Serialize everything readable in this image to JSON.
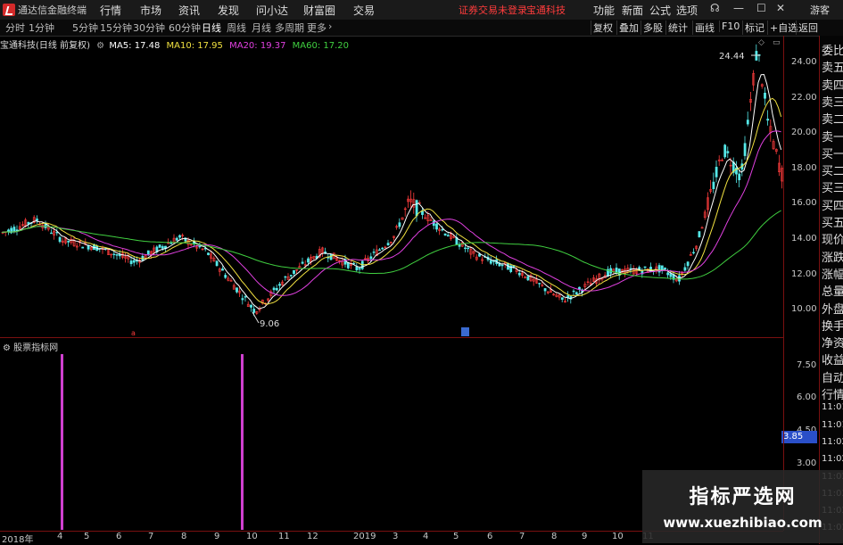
{
  "titlebar": {
    "app_name": "通达信金融终端",
    "menus": [
      "行情",
      "市场",
      "资讯",
      "发现",
      "问小达",
      "财富圈",
      "交易"
    ],
    "notice": "证券交易未登录",
    "stock_name": "宝通科技",
    "right_menus": [
      "功能",
      "新面",
      "公式",
      "选项"
    ],
    "guest": "游客"
  },
  "periods": [
    "分时",
    "1分钟",
    "5分钟",
    "15分钟",
    "30分钟",
    "60分钟",
    "日线",
    "周线",
    "月线",
    "多周期",
    "更多"
  ],
  "active_period": "日线",
  "right_buttons": [
    "复权",
    "叠加",
    "多股",
    "统计",
    "画线",
    "F10",
    "标记",
    "+自选",
    "返回"
  ],
  "legend": {
    "stock_label": "宝通科技(日线 前复权)",
    "ma5": "MA5: 17.48",
    "ma10": "MA10: 17.95",
    "ma20": "MA20: 19.37",
    "ma60": "MA60: 17.20"
  },
  "colors": {
    "ma5": "#ffffff",
    "ma10": "#f0e040",
    "ma20": "#e040e0",
    "ma60": "#40d040",
    "up": "#ff3c3c",
    "down": "#5ff",
    "bar": "#d040d0"
  },
  "price_axis": [
    "24.00",
    "22.00",
    "20.00",
    "18.00",
    "16.00",
    "14.00",
    "12.00",
    "10.00"
  ],
  "annotations": {
    "high": "24.44",
    "low": "9.06"
  },
  "indicator": {
    "title": "股票指标网",
    "axis": [
      "7.50",
      "6.00",
      "4.50",
      "3.00"
    ],
    "current": "3.85"
  },
  "side_panel": [
    "委比",
    "卖五",
    "卖四",
    "卖三",
    "卖二",
    "卖一",
    "买一",
    "买二",
    "买三",
    "买四",
    "买五",
    "现价",
    "涨跌",
    "涨幅",
    "总量",
    "外盘",
    "换手",
    "净资",
    "收益",
    "自动",
    "行情",
    "11:01",
    "11:01",
    "11:02",
    "11:02",
    "11:02",
    "11:02",
    "11:02",
    "11:02"
  ],
  "time_axis": [
    "2018年",
    "4",
    "5",
    "6",
    "7",
    "8",
    "9",
    "10",
    "11",
    "12",
    "2019",
    "3",
    "4",
    "5",
    "6",
    "7",
    "8",
    "9",
    "10",
    "11"
  ],
  "watermark": {
    "line1": "指标严选网",
    "line2": "www.xuezhibiao.com"
  }
}
